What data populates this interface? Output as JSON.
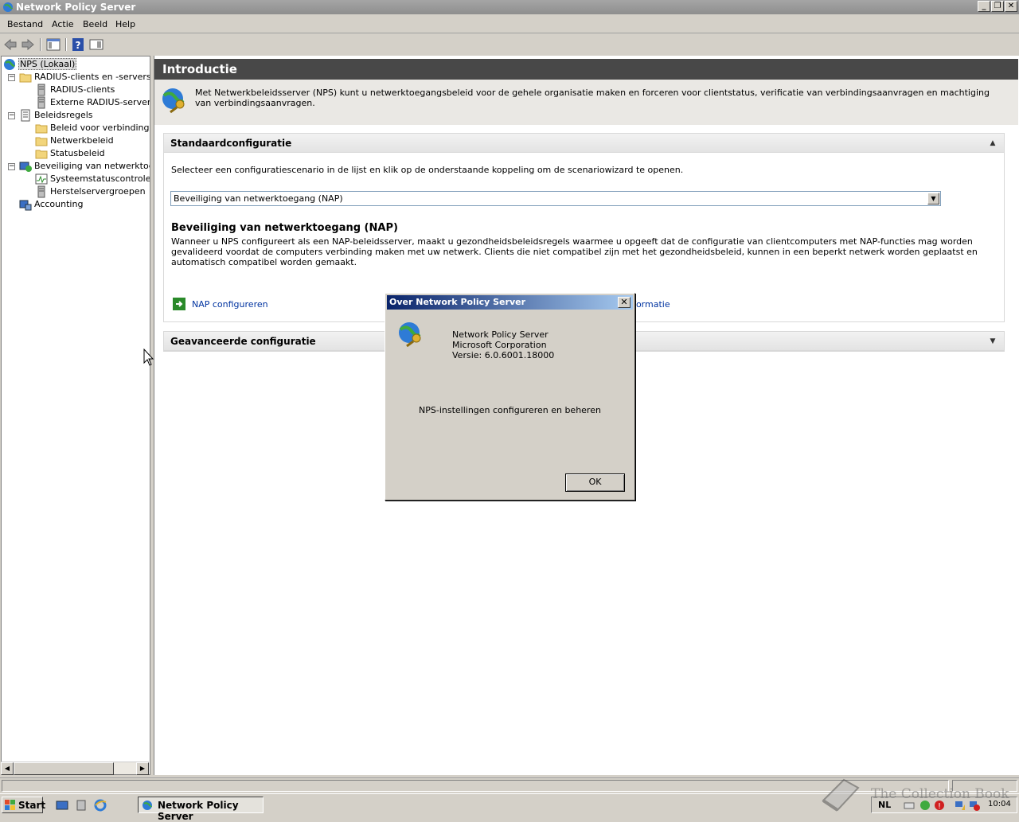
{
  "window": {
    "title": "Network Policy Server",
    "minimize": "_",
    "maximize": "❐",
    "close": "✕"
  },
  "menu": [
    "Bestand",
    "Actie",
    "Beeld",
    "Help"
  ],
  "toolbar_icons": [
    "back-arrow-icon",
    "forward-arrow-icon",
    "show-hide-tree-icon",
    "help-icon",
    "action-pane-icon"
  ],
  "tree": {
    "root": "NPS (Lokaal)",
    "radius_group": "RADIUS-clients en -servers",
    "radius_clients": "RADIUS-clients",
    "radius_remote": "Externe RADIUS-servergr",
    "policies": "Beleidsregels",
    "policy_conn": "Beleid voor verbindingsaa",
    "policy_network": "Netwerkbeleid",
    "policy_health": "Statusbeleid",
    "nap": "Beveiliging van netwerktoegan",
    "nap_shv": "Systeemstatuscontroles",
    "nap_remed": "Herstelservergroepen",
    "accounting": "Accounting",
    "expand_minus": "−"
  },
  "main": {
    "intro_title": "Introductie",
    "intro_text": "Met Netwerkbeleidsserver (NPS) kunt u netwerktoegangsbeleid voor de gehele organisatie maken en forceren voor clientstatus, verificatie van verbindingsaanvragen en machtiging van verbindingsaanvragen.",
    "std_config_title": "Standaardconfiguratie",
    "std_config_desc": "Selecteer een configuratiescenario in de lijst en klik op de onderstaande koppeling om de scenariowizard te openen.",
    "scenario_selected": "Beveiliging van netwerktoegang (NAP)",
    "nap_heading": "Beveiliging van netwerktoegang (NAP)",
    "nap_desc": "Wanneer u NPS configureert als een NAP-beleidsserver, maakt u gezondheidsbeleidsregels waarmee u opgeeft dat de configuratie van clientcomputers met NAP-functies mag worden gevalideerd voordat de computers verbinding maken met uw netwerk. Clients die niet compatibel zijn met het gezondheidsbeleid, kunnen in een beperkt netwerk worden geplaatst en automatisch compatibel worden gemaakt.",
    "configure_link": "NAP configureren",
    "more_info_link": "Meer informatie",
    "adv_config_title": "Geavanceerde configuratie",
    "collapse_glyph": "▲",
    "expand_glyph": "▼"
  },
  "dialog": {
    "title": "Over Network Policy Server",
    "close": "✕",
    "product": "Network Policy Server",
    "company": "Microsoft Corporation",
    "version": "Versie: 6.0.6001.18000",
    "description": "NPS-instellingen configureren en beheren",
    "ok": "OK"
  },
  "taskbar": {
    "start": "Start",
    "task": "Network Policy Server",
    "lang": "NL",
    "clock": "10:04"
  },
  "watermark": "The Collection Book",
  "colors": {
    "link": "#0033a0",
    "intro_header": "#484848",
    "dialog_title_start": "#0a246a",
    "dialog_title_end": "#a6caf0"
  }
}
